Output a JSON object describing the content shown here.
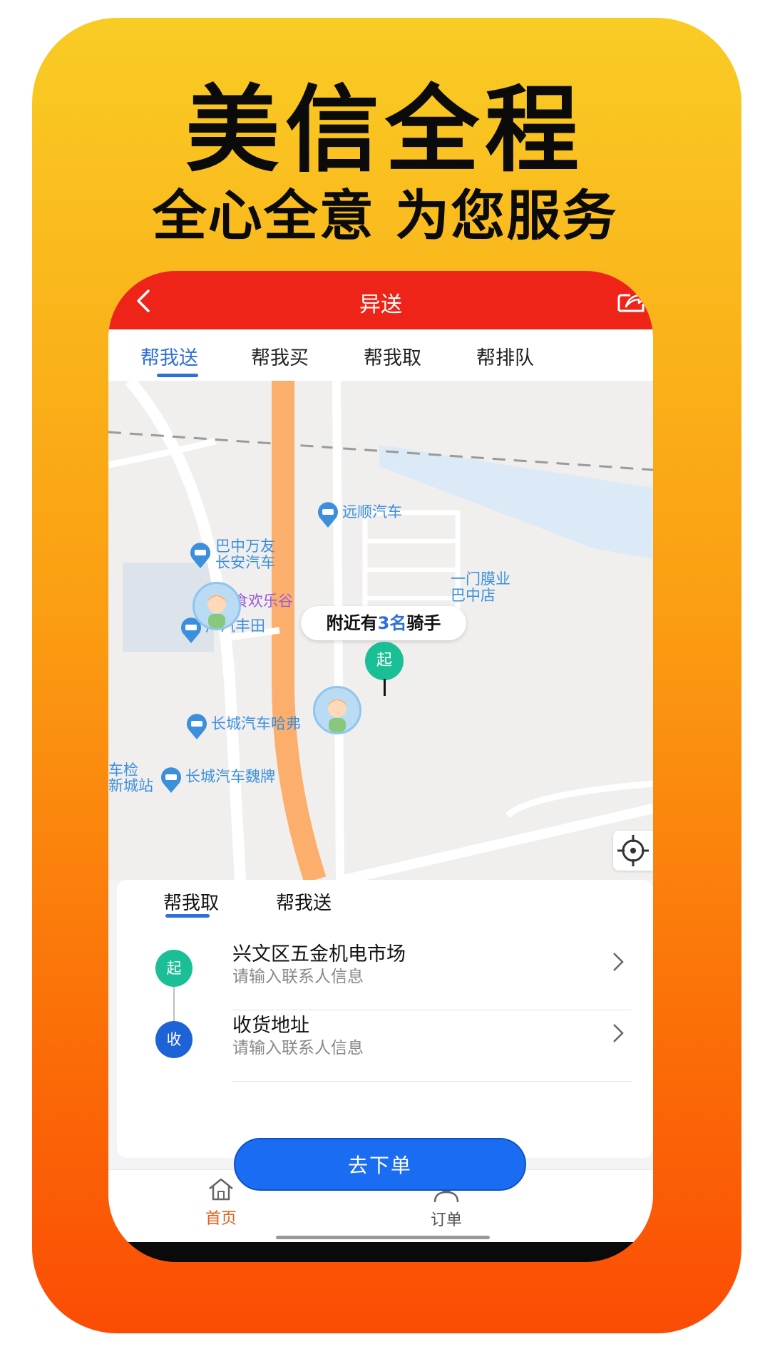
{
  "promo": {
    "headline": "美信全程",
    "subheadline": "全心全意 为您服务"
  },
  "app": {
    "title": "异送",
    "tabs": [
      "帮我送",
      "帮我买",
      "帮我取",
      "帮排队"
    ],
    "active_tab": "帮我送"
  },
  "map": {
    "riders_prefix": "附近有",
    "riders_count": "3名",
    "riders_suffix": "骑手",
    "start_marker": "起",
    "pois": {
      "p1": "远顺汽车",
      "p2": "巴中万友",
      "p2b": "长安汽车",
      "p3": "一门膜业",
      "p3b": "巴中店",
      "p4": "食欢乐谷",
      "p5": "广汽丰田",
      "p6": "长城汽车哈弗",
      "p7": "长城汽车魏牌",
      "p8": "车检",
      "p8b": "新城站"
    }
  },
  "order": {
    "tabs": [
      "帮我取",
      "帮我送"
    ],
    "active_tab": "帮我取",
    "pickup": {
      "marker": "起",
      "address": "兴文区五金机电市场",
      "contact_placeholder": "请输入联系人信息"
    },
    "dropoff": {
      "marker": "收",
      "address": "收货地址",
      "contact_placeholder": "请输入联系人信息"
    },
    "submit_label": "去下单"
  },
  "bottom_nav": {
    "home": "首页",
    "orders": "订单"
  },
  "colors": {
    "brand_red": "#ee2418",
    "accent_blue": "#1a6df2",
    "start_green": "#1bbf95",
    "nav_active": "#ee5a18"
  }
}
